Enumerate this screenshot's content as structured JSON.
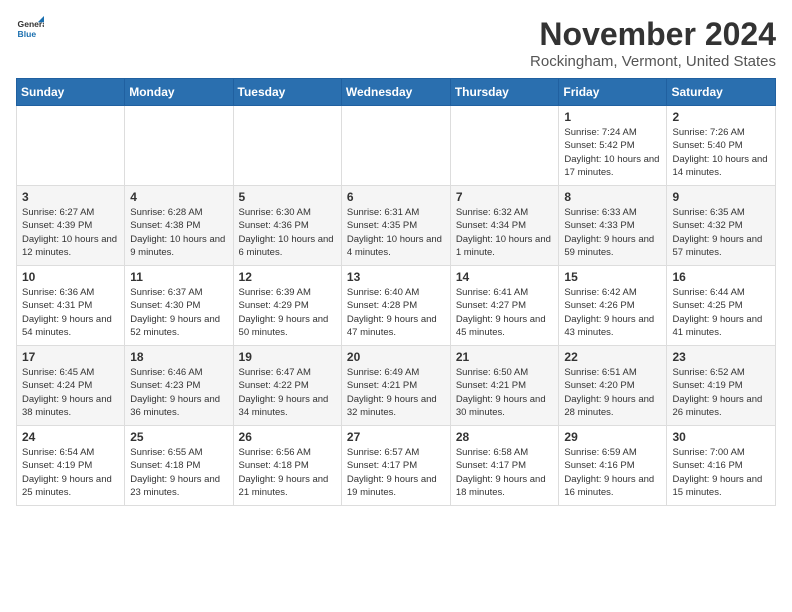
{
  "header": {
    "logo": {
      "general": "General",
      "blue": "Blue"
    },
    "title": "November 2024",
    "location": "Rockingham, Vermont, United States"
  },
  "weekdays": [
    "Sunday",
    "Monday",
    "Tuesday",
    "Wednesday",
    "Thursday",
    "Friday",
    "Saturday"
  ],
  "weeks": [
    [
      {
        "day": "",
        "info": ""
      },
      {
        "day": "",
        "info": ""
      },
      {
        "day": "",
        "info": ""
      },
      {
        "day": "",
        "info": ""
      },
      {
        "day": "",
        "info": ""
      },
      {
        "day": "1",
        "info": "Sunrise: 7:24 AM\nSunset: 5:42 PM\nDaylight: 10 hours and 17 minutes."
      },
      {
        "day": "2",
        "info": "Sunrise: 7:26 AM\nSunset: 5:40 PM\nDaylight: 10 hours and 14 minutes."
      }
    ],
    [
      {
        "day": "3",
        "info": "Sunrise: 6:27 AM\nSunset: 4:39 PM\nDaylight: 10 hours and 12 minutes."
      },
      {
        "day": "4",
        "info": "Sunrise: 6:28 AM\nSunset: 4:38 PM\nDaylight: 10 hours and 9 minutes."
      },
      {
        "day": "5",
        "info": "Sunrise: 6:30 AM\nSunset: 4:36 PM\nDaylight: 10 hours and 6 minutes."
      },
      {
        "day": "6",
        "info": "Sunrise: 6:31 AM\nSunset: 4:35 PM\nDaylight: 10 hours and 4 minutes."
      },
      {
        "day": "7",
        "info": "Sunrise: 6:32 AM\nSunset: 4:34 PM\nDaylight: 10 hours and 1 minute."
      },
      {
        "day": "8",
        "info": "Sunrise: 6:33 AM\nSunset: 4:33 PM\nDaylight: 9 hours and 59 minutes."
      },
      {
        "day": "9",
        "info": "Sunrise: 6:35 AM\nSunset: 4:32 PM\nDaylight: 9 hours and 57 minutes."
      }
    ],
    [
      {
        "day": "10",
        "info": "Sunrise: 6:36 AM\nSunset: 4:31 PM\nDaylight: 9 hours and 54 minutes."
      },
      {
        "day": "11",
        "info": "Sunrise: 6:37 AM\nSunset: 4:30 PM\nDaylight: 9 hours and 52 minutes."
      },
      {
        "day": "12",
        "info": "Sunrise: 6:39 AM\nSunset: 4:29 PM\nDaylight: 9 hours and 50 minutes."
      },
      {
        "day": "13",
        "info": "Sunrise: 6:40 AM\nSunset: 4:28 PM\nDaylight: 9 hours and 47 minutes."
      },
      {
        "day": "14",
        "info": "Sunrise: 6:41 AM\nSunset: 4:27 PM\nDaylight: 9 hours and 45 minutes."
      },
      {
        "day": "15",
        "info": "Sunrise: 6:42 AM\nSunset: 4:26 PM\nDaylight: 9 hours and 43 minutes."
      },
      {
        "day": "16",
        "info": "Sunrise: 6:44 AM\nSunset: 4:25 PM\nDaylight: 9 hours and 41 minutes."
      }
    ],
    [
      {
        "day": "17",
        "info": "Sunrise: 6:45 AM\nSunset: 4:24 PM\nDaylight: 9 hours and 38 minutes."
      },
      {
        "day": "18",
        "info": "Sunrise: 6:46 AM\nSunset: 4:23 PM\nDaylight: 9 hours and 36 minutes."
      },
      {
        "day": "19",
        "info": "Sunrise: 6:47 AM\nSunset: 4:22 PM\nDaylight: 9 hours and 34 minutes."
      },
      {
        "day": "20",
        "info": "Sunrise: 6:49 AM\nSunset: 4:21 PM\nDaylight: 9 hours and 32 minutes."
      },
      {
        "day": "21",
        "info": "Sunrise: 6:50 AM\nSunset: 4:21 PM\nDaylight: 9 hours and 30 minutes."
      },
      {
        "day": "22",
        "info": "Sunrise: 6:51 AM\nSunset: 4:20 PM\nDaylight: 9 hours and 28 minutes."
      },
      {
        "day": "23",
        "info": "Sunrise: 6:52 AM\nSunset: 4:19 PM\nDaylight: 9 hours and 26 minutes."
      }
    ],
    [
      {
        "day": "24",
        "info": "Sunrise: 6:54 AM\nSunset: 4:19 PM\nDaylight: 9 hours and 25 minutes."
      },
      {
        "day": "25",
        "info": "Sunrise: 6:55 AM\nSunset: 4:18 PM\nDaylight: 9 hours and 23 minutes."
      },
      {
        "day": "26",
        "info": "Sunrise: 6:56 AM\nSunset: 4:18 PM\nDaylight: 9 hours and 21 minutes."
      },
      {
        "day": "27",
        "info": "Sunrise: 6:57 AM\nSunset: 4:17 PM\nDaylight: 9 hours and 19 minutes."
      },
      {
        "day": "28",
        "info": "Sunrise: 6:58 AM\nSunset: 4:17 PM\nDaylight: 9 hours and 18 minutes."
      },
      {
        "day": "29",
        "info": "Sunrise: 6:59 AM\nSunset: 4:16 PM\nDaylight: 9 hours and 16 minutes."
      },
      {
        "day": "30",
        "info": "Sunrise: 7:00 AM\nSunset: 4:16 PM\nDaylight: 9 hours and 15 minutes."
      }
    ]
  ]
}
